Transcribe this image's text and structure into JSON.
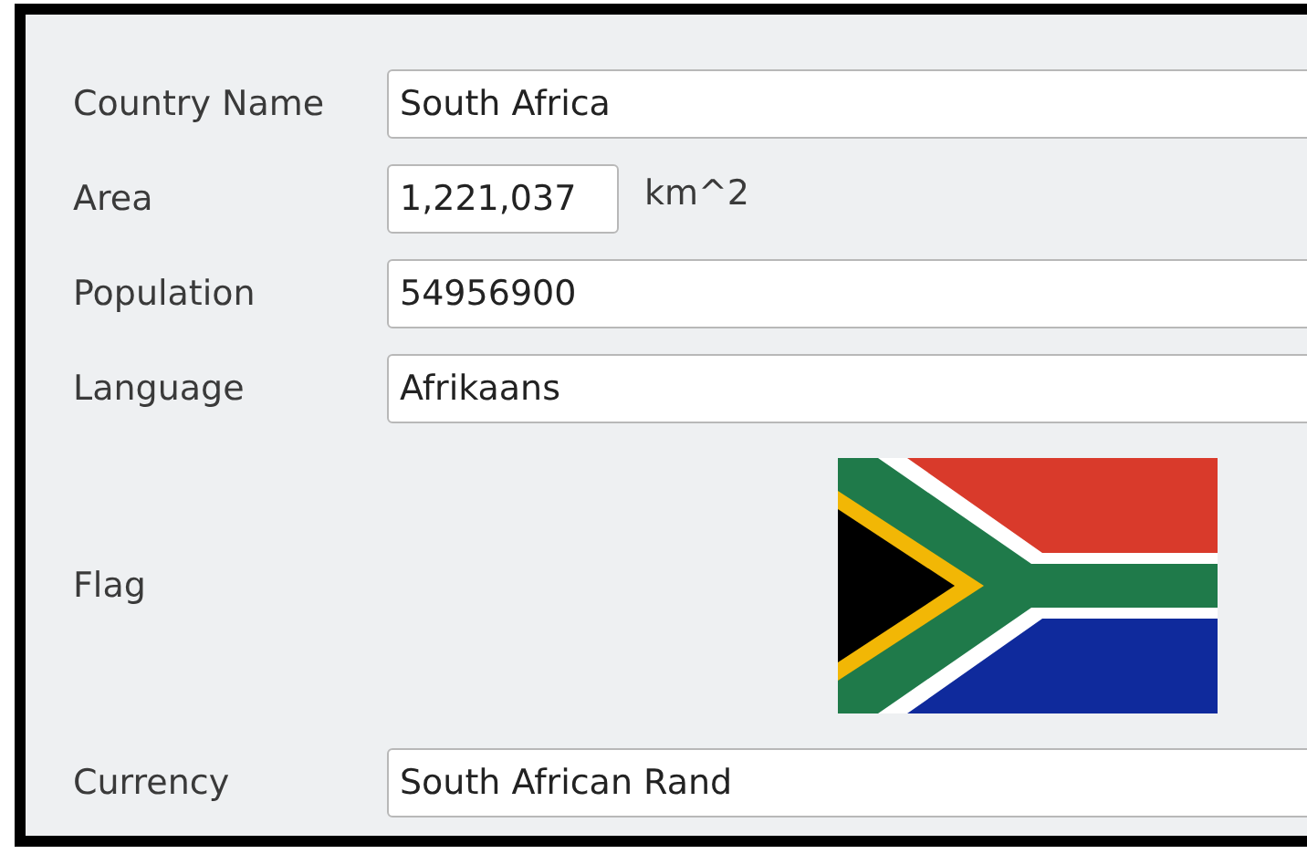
{
  "fields": [
    {
      "kind": "text",
      "label": "Country Name",
      "value": "South Africa"
    },
    {
      "kind": "unit",
      "label": "Area",
      "value": "1,221,037",
      "unit": "km^2"
    },
    {
      "kind": "text",
      "label": "Population",
      "value": "54956900"
    },
    {
      "kind": "text",
      "label": "Language",
      "value": "Afrikaans"
    },
    {
      "kind": "flag",
      "label": "Flag"
    },
    {
      "kind": "text",
      "label": "Currency",
      "value": "South African Rand"
    }
  ]
}
